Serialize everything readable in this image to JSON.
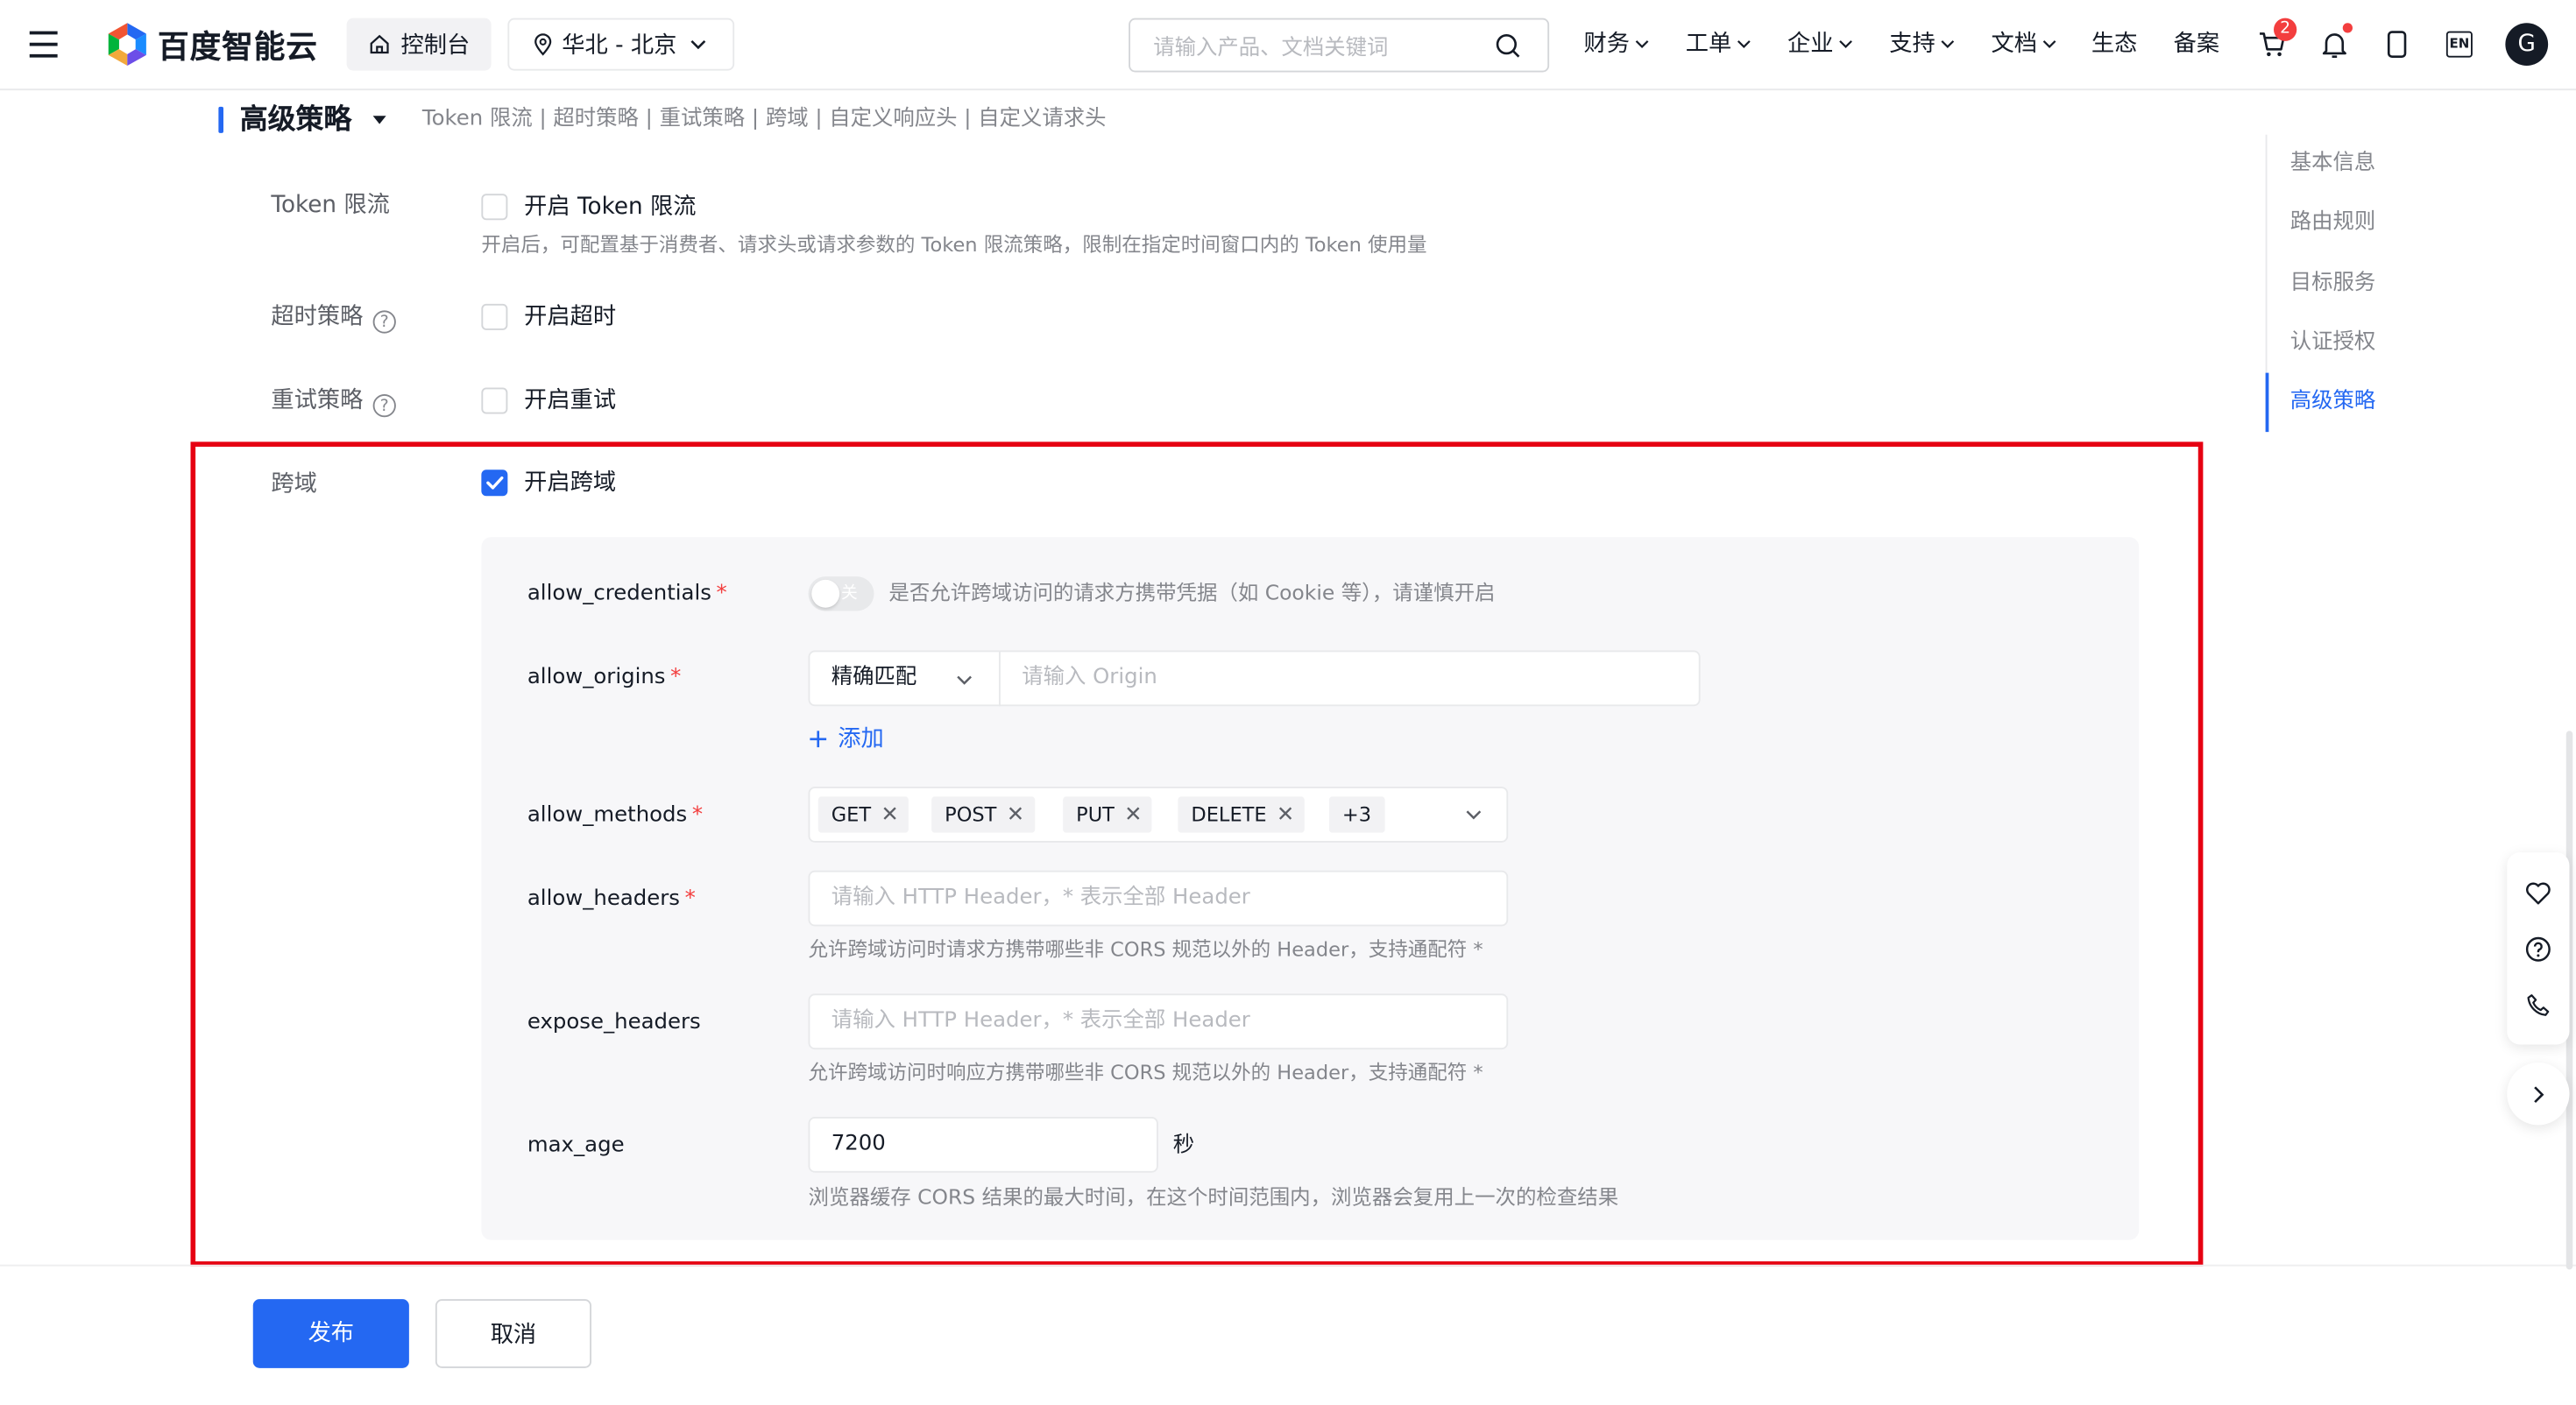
{
  "header": {
    "brand": "百度智能云",
    "console_label": "控制台",
    "region_label": "华北 - 北京",
    "search_placeholder": "请输入产品、文档关键词",
    "menu": [
      "财务",
      "工单",
      "企业",
      "支持",
      "文档",
      "生态",
      "备案"
    ],
    "cart_badge": "2",
    "lang_label": "EN",
    "avatar_letter": "G"
  },
  "section": {
    "title": "高级策略",
    "tabs": "Token 限流 | 超时策略 | 重试策略 | 跨域 | 自定义响应头 | 自定义请求头"
  },
  "form": {
    "token": {
      "label": "Token 限流",
      "checkbox_label": "开启 Token 限流",
      "hint": "开启后，可配置基于消费者、请求头或请求参数的 Token 限流策略，限制在指定时间窗口内的 Token 使用量",
      "checked": false
    },
    "timeout": {
      "label": "超时策略",
      "checkbox_label": "开启超时",
      "checked": false
    },
    "retry": {
      "label": "重试策略",
      "checkbox_label": "开启重试",
      "checked": false
    },
    "cors": {
      "label": "跨域",
      "checkbox_label": "开启跨域",
      "checked": true,
      "allow_credentials": {
        "label": "allow_credentials",
        "switch_text": "关",
        "hint": "是否允许跨域访问的请求方携带凭据（如 Cookie 等），请谨慎开启"
      },
      "allow_origins": {
        "label": "allow_origins",
        "match_select": "精确匹配",
        "placeholder": "请输入 Origin",
        "add_label": "添加"
      },
      "allow_methods": {
        "label": "allow_methods",
        "tags": [
          "GET",
          "POST",
          "PUT",
          "DELETE"
        ],
        "more": "+3"
      },
      "allow_headers": {
        "label": "allow_headers",
        "placeholder": "请输入 HTTP Header，* 表示全部 Header",
        "hint": "允许跨域访问时请求方携带哪些非 CORS 规范以外的 Header，支持通配符 *"
      },
      "expose_headers": {
        "label": "expose_headers",
        "placeholder": "请输入 HTTP Header，* 表示全部 Header",
        "hint": "允许跨域访问时响应方携带哪些非 CORS 规范以外的 Header，支持通配符 *"
      },
      "max_age": {
        "label": "max_age",
        "value": "7200",
        "unit": "秒",
        "hint": "浏览器缓存 CORS 结果的最大时间，在这个时间范围内，浏览器会复用上一次的检查结果"
      }
    }
  },
  "footer": {
    "publish_label": "发布",
    "cancel_label": "取消"
  },
  "side_nav": {
    "items": [
      "基本信息",
      "路由规则",
      "目标服务",
      "认证授权",
      "高级策略"
    ],
    "active": "高级策略"
  },
  "colors": {
    "primary": "#2468f2",
    "highlight_border": "#e60012",
    "required": "#f33e3e"
  }
}
